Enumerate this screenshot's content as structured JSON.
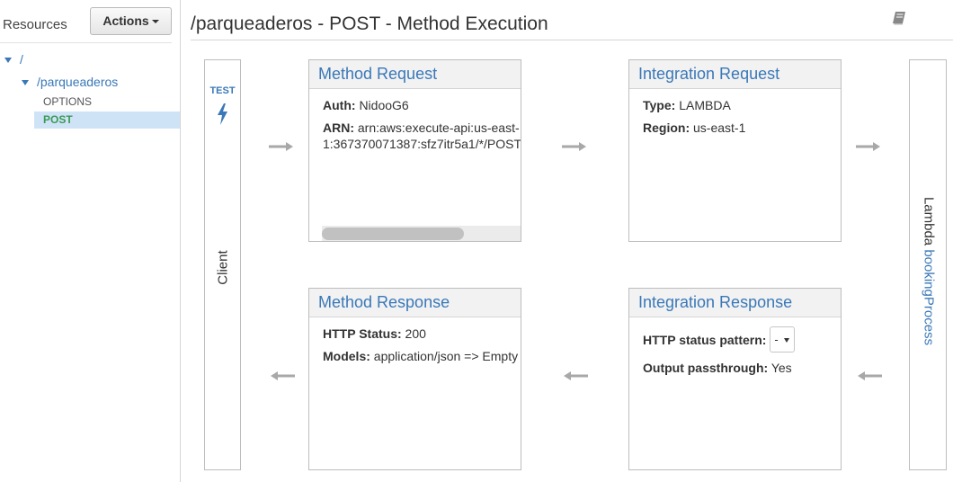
{
  "sidebar": {
    "title": "Resources",
    "actions_label": "Actions",
    "tree": {
      "root": "/",
      "resource": "/parqueaderos",
      "methods": [
        "OPTIONS",
        "POST"
      ],
      "selected": "POST"
    }
  },
  "header": {
    "title": "/parqueaderos - POST - Method Execution",
    "help_icon": "book-icon"
  },
  "client": {
    "test_label": "TEST",
    "test_icon": "lightning-bolt-icon",
    "label": "Client"
  },
  "lambda": {
    "prefix": "Lambda ",
    "function_name": "bookingProcess"
  },
  "method_request": {
    "title": "Method Request",
    "auth_label": "Auth:",
    "auth_value": "NidooG6",
    "arn_label": "ARN:",
    "arn_value_line1": "arn:aws:execute-api:us-east-",
    "arn_value_line2": "1:367370071387:sfz7itr5a1/*/POST"
  },
  "integration_request": {
    "title": "Integration Request",
    "type_label": "Type:",
    "type_value": "LAMBDA",
    "region_label": "Region:",
    "region_value": "us-east-1"
  },
  "method_response": {
    "title": "Method Response",
    "status_label": "HTTP Status:",
    "status_value": "200",
    "models_label": "Models:",
    "models_value": "application/json => Empty"
  },
  "integration_response": {
    "title": "Integration Response",
    "pattern_label": "HTTP status pattern:",
    "pattern_value": "-",
    "passthrough_label": "Output passthrough:",
    "passthrough_value": "Yes"
  },
  "colors": {
    "link": "#3a78b8",
    "selected_bg": "#cfe3f7",
    "post_green": "#3a9a55",
    "arrow_gray": "#a8a8a8"
  }
}
